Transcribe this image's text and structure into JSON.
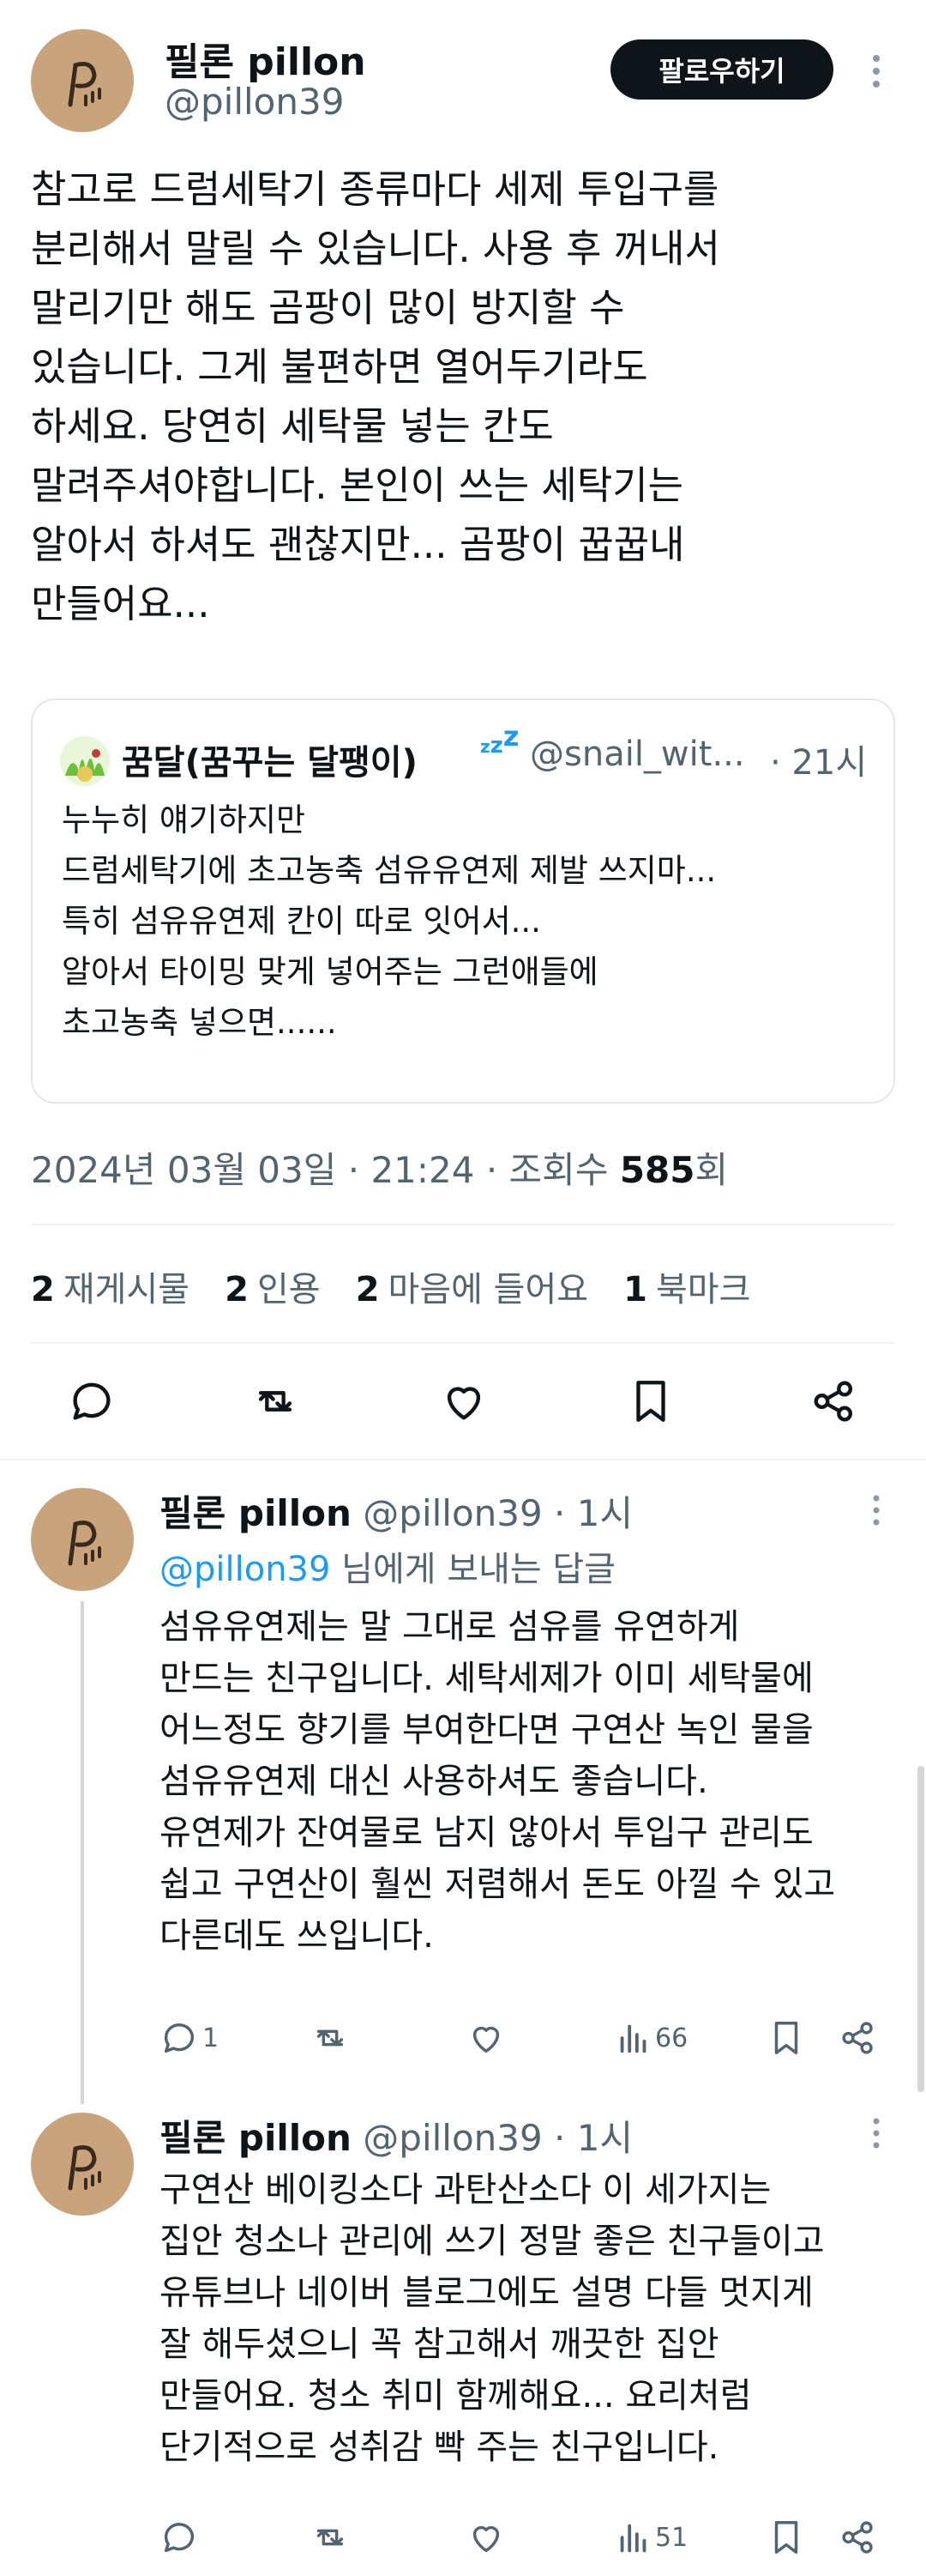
{
  "main_tweet": {
    "display_name": "필론 pillon",
    "handle": "@pillon39",
    "follow_label": "팔로우하기",
    "text": "참고로 드럼세탁기 종류마다 세제 투입구를\n분리해서 말릴 수 있습니다. 사용 후 꺼내서\n말리기만 해도 곰팡이 많이 방지할 수\n있습니다. 그게 불편하면 열어두기라도\n하세요. 당연히 세탁물 넣는 칸도\n말려주셔야합니다. 본인이 쓰는 세탁기는\n알아서 하셔도 괜찮지만... 곰팡이 꿉꿉내\n만들어요...",
    "quote": {
      "display_name": "꿈달(꿈꾸는 달팽이)",
      "zzz": "z",
      "handle": "@snail_wit...",
      "time": "· 21시",
      "text": "누누히 얘기하지만\n드럼세탁기에 초고농축 섬유유연제 제발 쓰지마...\n특히 섬유유연제 칸이 따로 잇어서...\n알아서 타이밍 맞게 넣어주는 그런애들에\n초고농축 넣으면......"
    },
    "timestamp": "2024년 03월 03일 · 21:24 · 조회수 ",
    "views": "585",
    "views_suffix": "회",
    "stats": [
      {
        "count": "2",
        "label": "재게시물"
      },
      {
        "count": "2",
        "label": "인용"
      },
      {
        "count": "2",
        "label": "마음에 들어요"
      },
      {
        "count": "1",
        "label": "북마크"
      }
    ]
  },
  "replies": [
    {
      "display_name": "필론 pillon",
      "handle": "@pillon39 · 1시",
      "reply_to_handle": "@pillon39",
      "reply_to_suffix": " 님에게 보내는 답글",
      "text": "섬유유연제는 말 그대로 섬유를 유연하게\n만드는 친구입니다. 세탁세제가 이미 세탁물에\n어느정도 향기를 부여한다면 구연산 녹인 물을\n섬유유연제 대신 사용하셔도 좋습니다.\n유연제가 잔여물로 남지 않아서 투입구 관리도\n쉽고 구연산이 훨씬 저렴해서 돈도 아낄 수 있고\n다른데도 쓰입니다.",
      "reply_count": "1",
      "views": "66"
    },
    {
      "display_name": "필론 pillon",
      "handle": "@pillon39 · 1시",
      "text": "구연산 베이킹소다 과탄산소다 이 세가지는\n집안 청소나 관리에 쓰기 정말 좋은 친구들이고\n유튜브나 네이버 블로그에도 설명 다들 멋지게\n잘 해두셨으니 꼭 참고해서 깨끗한 집안\n만들어요. 청소 취미 함께해요... 요리처럼\n단기적으로 성취감 빡 주는 친구입니다.",
      "views": "51"
    }
  ],
  "colors": {
    "text": "#0f1419",
    "secondary": "#536471",
    "link": "#1d9bf0",
    "avatar": "#c9a37c",
    "follow_button": "#0f1419"
  }
}
